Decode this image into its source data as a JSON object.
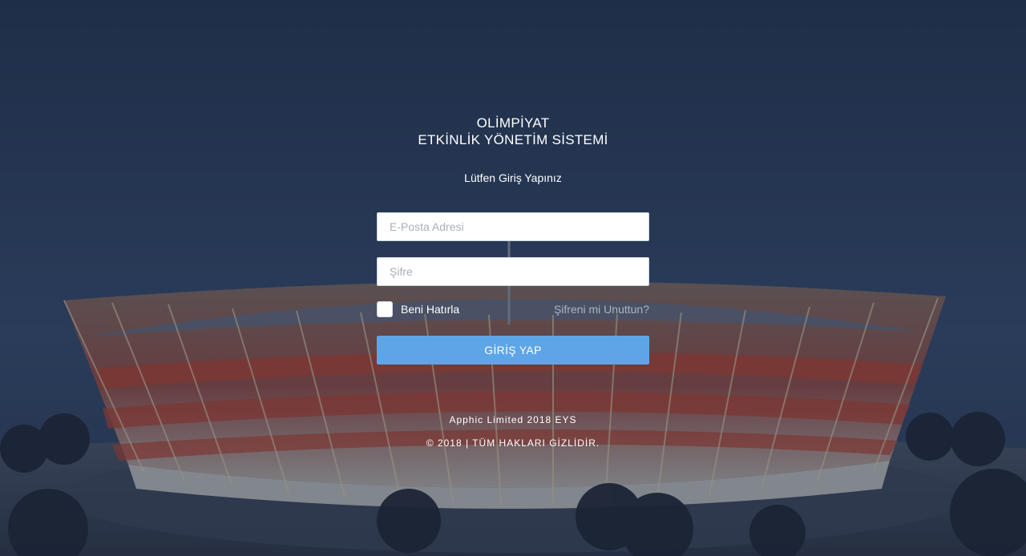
{
  "header": {
    "title_line1": "OLİMPİYAT",
    "title_line2": "ETKİNLİK YÖNETİM SİSTEMİ",
    "subtitle": "Lütfen Giriş Yapınız"
  },
  "form": {
    "email_placeholder": "E-Posta Adresi",
    "email_value": "",
    "password_placeholder": "Şifre",
    "password_value": "",
    "remember_label": "Beni Hatırla",
    "remember_checked": false,
    "forgot_label": "Şifreni mi Unuttun?",
    "submit_label": "GİRİŞ YAP"
  },
  "footer": {
    "company": "Apphic Limited 2018 EYS",
    "copyright": "© 2018 | TÜM HAKLARI GİZLİDİR."
  },
  "colors": {
    "background": "#2b3f60",
    "button": "#5ea5e8",
    "stadium_accent": "#c0392b"
  }
}
